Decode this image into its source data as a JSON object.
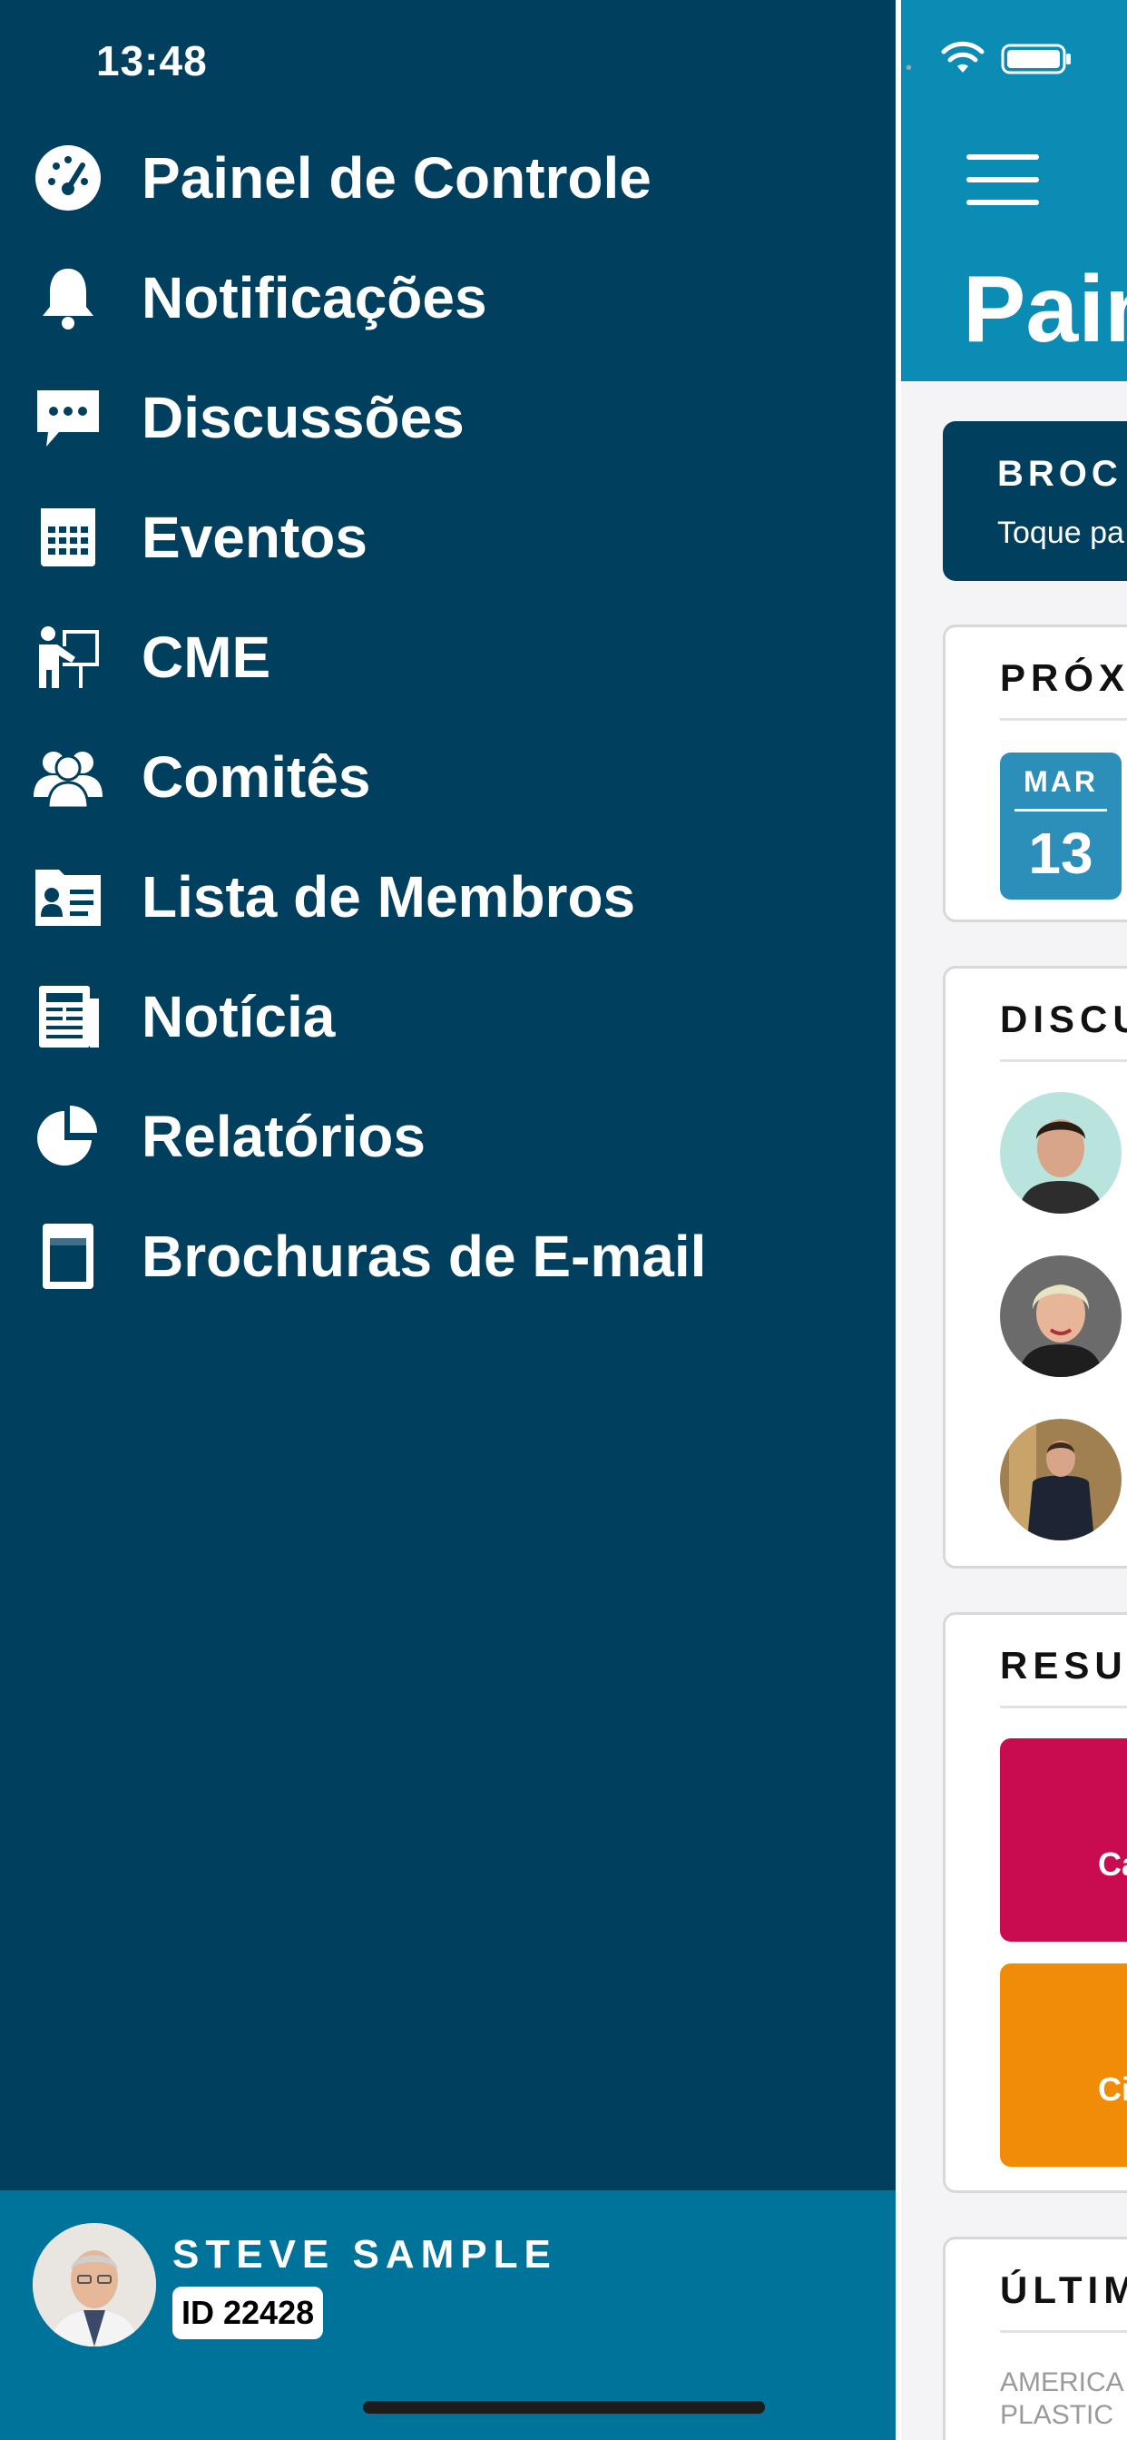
{
  "status_bar": {
    "time": "13:48"
  },
  "drawer": {
    "items": [
      {
        "label": "Painel de Controle",
        "icon": "dashboard-gauge-icon"
      },
      {
        "label": "Notificações",
        "icon": "bell-icon"
      },
      {
        "label": "Discussões",
        "icon": "chat-bubble-icon"
      },
      {
        "label": "Eventos",
        "icon": "calendar-icon"
      },
      {
        "label": "CME",
        "icon": "presentation-icon"
      },
      {
        "label": "Comitês",
        "icon": "users-icon"
      },
      {
        "label": "Lista de Membros",
        "icon": "member-card-icon"
      },
      {
        "label": "Notícia",
        "icon": "newspaper-icon"
      },
      {
        "label": "Relatórios",
        "icon": "pie-chart-icon"
      },
      {
        "label": "Brochuras de E-mail",
        "icon": "brochure-icon"
      }
    ],
    "profile": {
      "name": "STEVE SAMPLE",
      "id": "ID 22428"
    }
  },
  "main": {
    "title": "Pain",
    "brochure_card": {
      "title": "BROC",
      "subtitle": "Toque pa"
    },
    "upcoming_card": {
      "title": "PRÓX",
      "date_month": "MAR",
      "date_day": "13"
    },
    "discussions_card": {
      "title": "DISCU"
    },
    "summary_card": {
      "title": "RESUI",
      "tile1_label": "Ca",
      "tile2_label": "Ci"
    },
    "latest_card": {
      "title": "ÚLTIM",
      "meta_line1": "AMERICA",
      "meta_line2": "PLASTIC"
    }
  },
  "colors": {
    "drawer_bg": "#003f5e",
    "profile_bg": "#00739a",
    "header_bg": "#0a8cb4",
    "tile_pink": "#c90b50",
    "tile_orange": "#f08c07",
    "date_badge": "#2b8fb9"
  }
}
